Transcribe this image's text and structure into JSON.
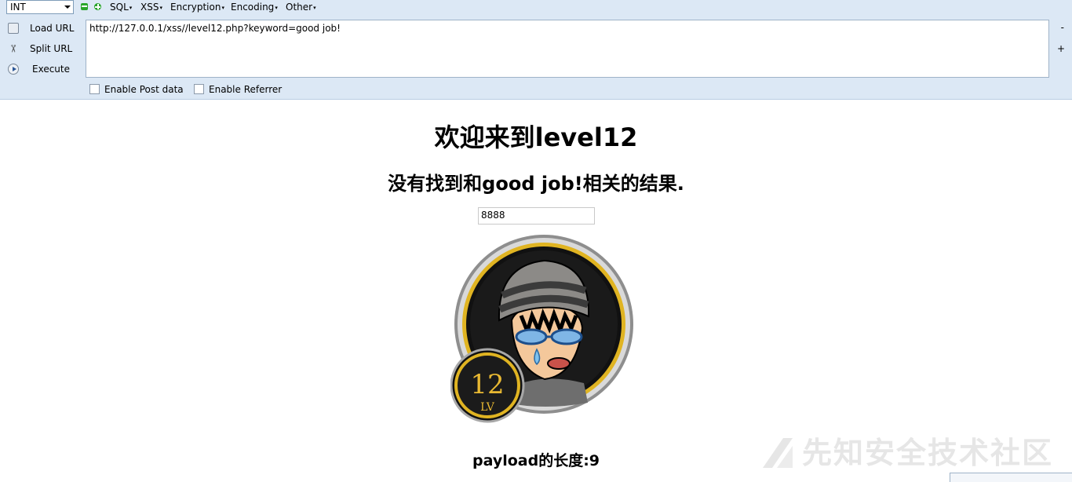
{
  "hackbar": {
    "select_value": "INT",
    "menus": [
      "SQL",
      "XSS",
      "Encryption",
      "Encoding",
      "Other"
    ],
    "load_url": "Load URL",
    "split_url": "Split URL",
    "execute": "Execute",
    "url": "http://127.0.0.1/xss//level12.php?keyword=good job!",
    "minus": "-",
    "plus": "+",
    "enable_post": "Enable Post data",
    "enable_referrer": "Enable Referrer"
  },
  "page": {
    "title": "欢迎来到level12",
    "result": "没有找到和good job!相关的结果.",
    "input_value": "8888",
    "badge_number": "12",
    "badge_lv": "LV",
    "payload_len": "payload的长度:9"
  },
  "watermark": {
    "text": "先知安全技术社区"
  }
}
